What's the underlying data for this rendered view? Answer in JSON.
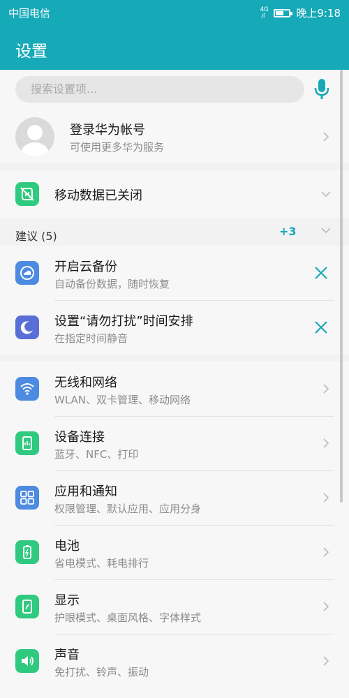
{
  "status": {
    "carrier": "中国电信",
    "signal": "4G\n.ıl",
    "time": "晚上9:18",
    "battery_level": 0.6
  },
  "header": {
    "title": "设置"
  },
  "search": {
    "placeholder": "搜索设置项..."
  },
  "account": {
    "title": "登录华为帐号",
    "subtitle": "可使用更多华为服务"
  },
  "mobile_data": {
    "title": "移动数据已关闭"
  },
  "suggestions": {
    "label": "建议 (5)",
    "more": "+3",
    "items": [
      {
        "title": "开启云备份",
        "subtitle": "自动备份数据，随时恢复"
      },
      {
        "title": "设置“请勿打扰”时间安排",
        "subtitle": "在指定时间静音"
      }
    ]
  },
  "settings": [
    {
      "title": "无线和网络",
      "subtitle": "WLAN、双卡管理、移动网络",
      "icon": "wifi-icon"
    },
    {
      "title": "设备连接",
      "subtitle": "蓝牙、NFC、打印",
      "icon": "device-connection-icon"
    },
    {
      "title": "应用和通知",
      "subtitle": "权限管理、默认应用、应用分身",
      "icon": "apps-icon"
    },
    {
      "title": "电池",
      "subtitle": "省电模式、耗电排行",
      "icon": "battery-icon"
    },
    {
      "title": "显示",
      "subtitle": "护眼模式、桌面风格、字体样式",
      "icon": "display-icon"
    },
    {
      "title": "声音",
      "subtitle": "免打扰、铃声、振动",
      "icon": "sound-icon"
    }
  ],
  "colors": {
    "header": "#16a9b8",
    "green": "#2fca7f",
    "blue": "#4d8be0",
    "accent": "#16a9b8"
  }
}
